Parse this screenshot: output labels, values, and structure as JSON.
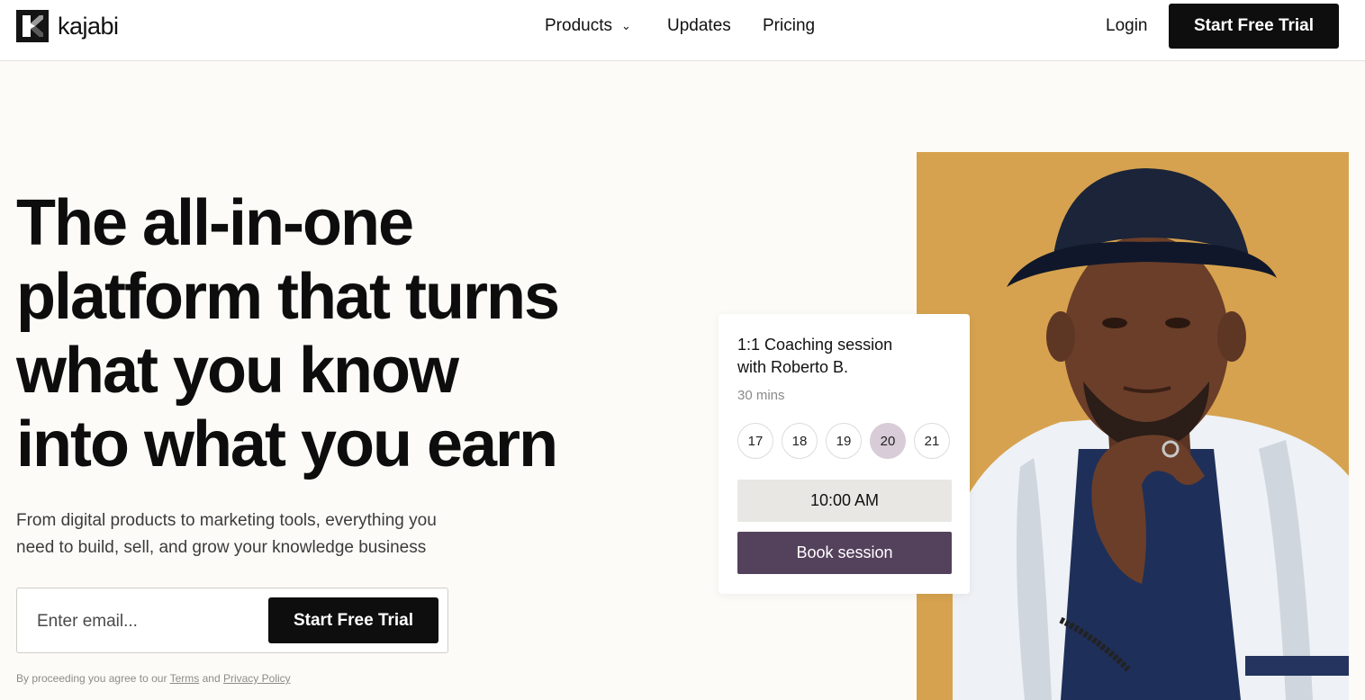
{
  "brand": {
    "name": "kajabi",
    "logo_icon": "kajabi-k-mark-icon"
  },
  "nav": {
    "items": [
      {
        "label": "Products",
        "icon": "chevron-down-icon"
      },
      {
        "label": "Updates"
      },
      {
        "label": "Pricing"
      }
    ],
    "login": "Login",
    "cta": "Start Free Trial"
  },
  "hero": {
    "headline_lines": [
      "The all-in-one",
      "platform that turns",
      "what you know",
      "into what you earn"
    ],
    "subtext_lines": [
      "From digital products to marketing tools, everything you",
      "need to build, sell, and grow your knowledge business"
    ],
    "email_placeholder": "Enter email...",
    "cta": "Start Free Trial",
    "legal": {
      "prefix": "By proceeding you agree to our",
      "terms": "Terms",
      "and": "and",
      "privacy": "Privacy Policy"
    }
  },
  "booking_card": {
    "title_lines": [
      "1:1 Coaching session",
      "with Roberto B."
    ],
    "duration": "30 mins",
    "dates": [
      "17",
      "18",
      "19",
      "20",
      "21"
    ],
    "selected_date": "20",
    "time": "10:00 AM",
    "button": "Book session"
  },
  "colors": {
    "photo_background": "#d6a24f",
    "primary_button": "#0e0e0e",
    "book_button": "#54415c",
    "selected_date": "#d7ccd8"
  }
}
